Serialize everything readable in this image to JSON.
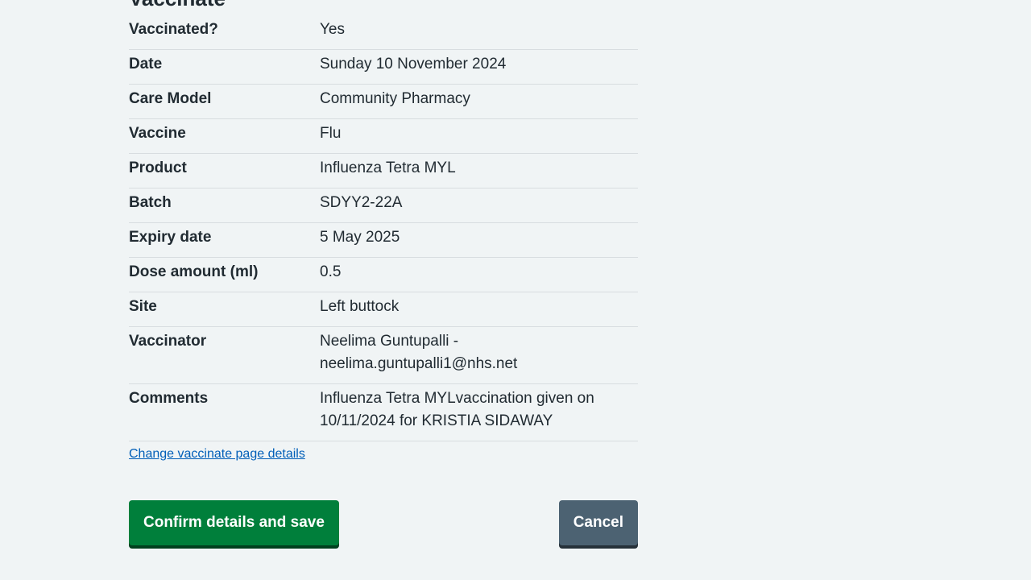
{
  "section": {
    "heading": "Vaccinate"
  },
  "summary": {
    "rows": [
      {
        "key": "Vaccinated?",
        "value": "Yes"
      },
      {
        "key": "Date",
        "value": "Sunday 10 November 2024"
      },
      {
        "key": "Care Model",
        "value": "Community Pharmacy"
      },
      {
        "key": "Vaccine",
        "value": "Flu"
      },
      {
        "key": "Product",
        "value": "Influenza Tetra MYL"
      },
      {
        "key": "Batch",
        "value": "SDYY2-22A"
      },
      {
        "key": "Expiry date",
        "value": "5 May 2025"
      },
      {
        "key": "Dose amount (ml)",
        "value": "0.5"
      },
      {
        "key": "Site",
        "value": "Left buttock"
      },
      {
        "key": "Vaccinator",
        "value": "Neelima Guntupalli - neelima.guntupalli1@nhs.net"
      },
      {
        "key": "Comments",
        "value": "Influenza Tetra MYLvaccination given on 10/11/2024 for KRISTIA SIDAWAY"
      }
    ]
  },
  "links": {
    "change_details": "Change vaccinate page details"
  },
  "actions": {
    "confirm_label": "Confirm details and save",
    "cancel_label": "Cancel"
  },
  "colors": {
    "background": "#f0f4f5",
    "text": "#212b32",
    "link": "#005eb8",
    "confirm_button": "#007f3b",
    "cancel_button": "#4c6272",
    "divider": "#d8dde0"
  }
}
